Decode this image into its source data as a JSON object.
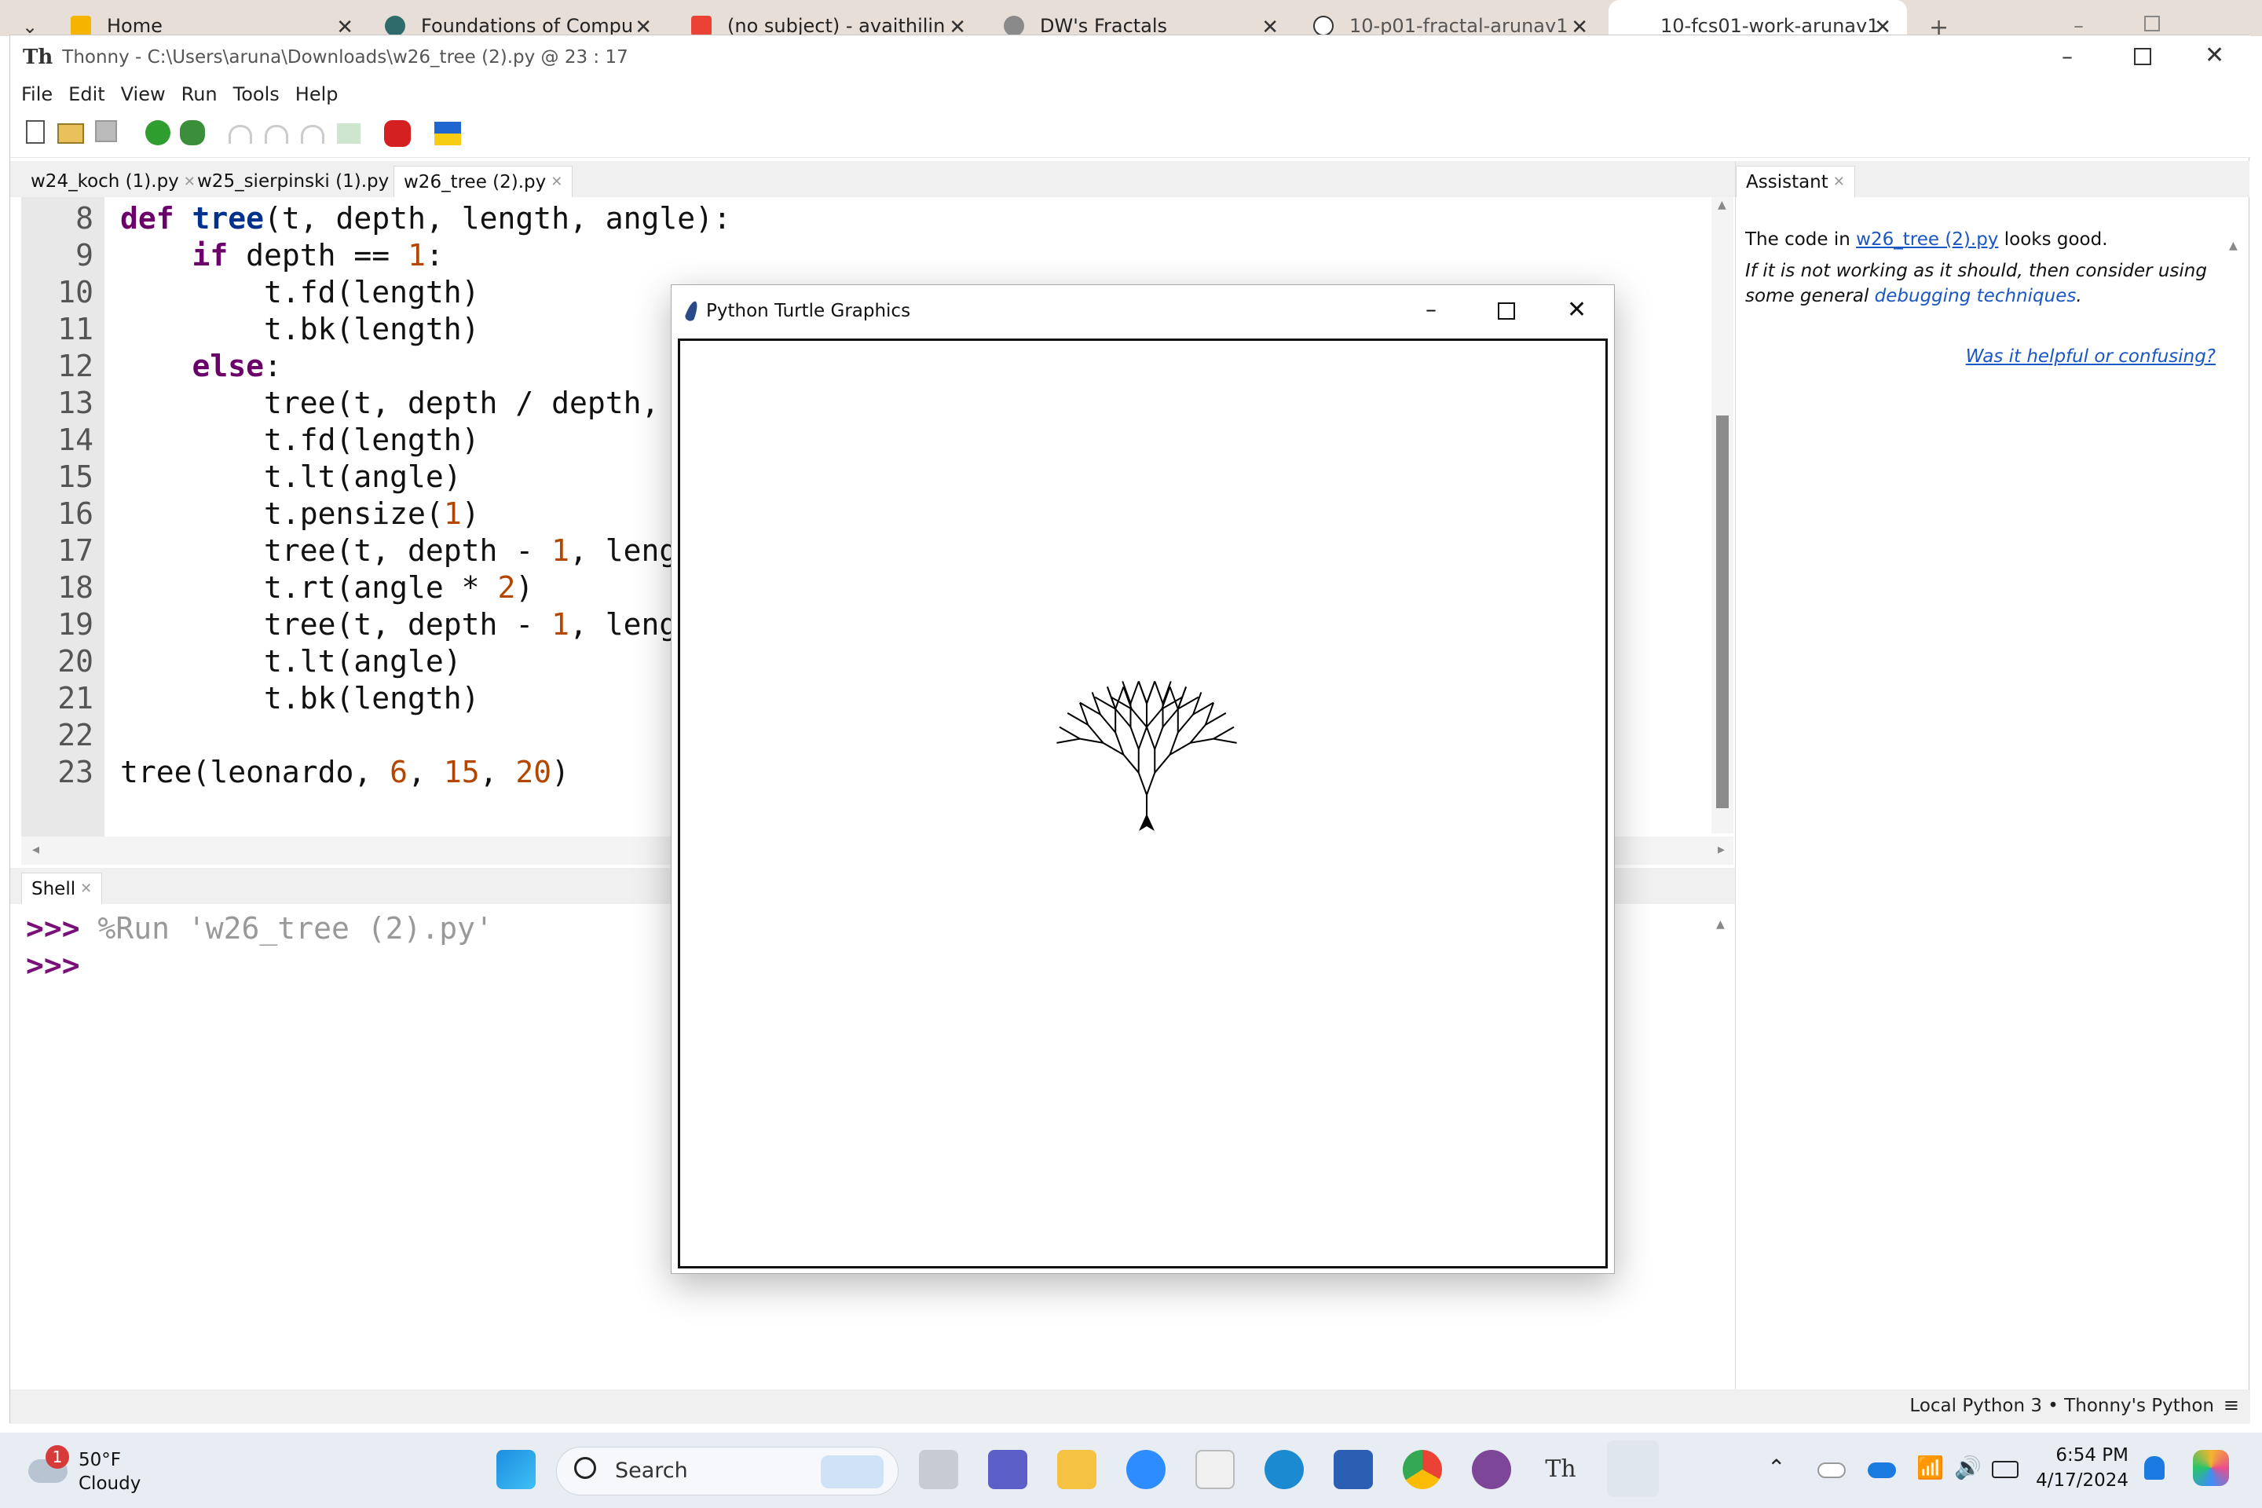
{
  "browser_tabs": [
    {
      "label": "Home"
    },
    {
      "label": "Foundations of Compu"
    },
    {
      "label": "(no subject) - avaithilin"
    },
    {
      "label": "DW's Fractals"
    },
    {
      "label": "10-p01-fractal-arunav1"
    },
    {
      "label": "10-fcs01-work-arunav1"
    }
  ],
  "window": {
    "title": "Thonny  -  C:\\Users\\aruna\\Downloads\\w26_tree (2).py  @  23 : 17"
  },
  "menu": [
    "File",
    "Edit",
    "View",
    "Run",
    "Tools",
    "Help"
  ],
  "editor_tabs": [
    {
      "label": "w24_koch (1).py"
    },
    {
      "label": "w25_sierpinski (1).py"
    },
    {
      "label": "w26_tree (2).py"
    }
  ],
  "editor": {
    "line_numbers": [
      "8",
      "9",
      "10",
      "11",
      "12",
      "13",
      "14",
      "15",
      "16",
      "17",
      "18",
      "19",
      "20",
      "21",
      "22",
      "23"
    ]
  },
  "shell": {
    "tab": "Shell",
    "prompt": ">>>",
    "command": "%Run 'w26_tree (2).py'"
  },
  "assistant": {
    "tab": "Assistant",
    "line1_pre": "The code in ",
    "line1_link": "w26_tree (2).py",
    "line1_post": " looks good.",
    "line2_pre": "If it is not working as it should, then consider using some general ",
    "line2_link": "debugging techniques",
    "line2_post": ".",
    "feedback_link": "Was it helpful or confusing?"
  },
  "status": {
    "interpreter": "Local Python 3  •  Thonny's Python"
  },
  "turtle_window": {
    "title": "Python Turtle Graphics"
  },
  "taskbar": {
    "weather_temp": "50°F",
    "weather_desc": "Cloudy",
    "weather_badge": "1",
    "search_placeholder": "Search",
    "time": "6:54 PM",
    "date": "4/17/2024"
  }
}
